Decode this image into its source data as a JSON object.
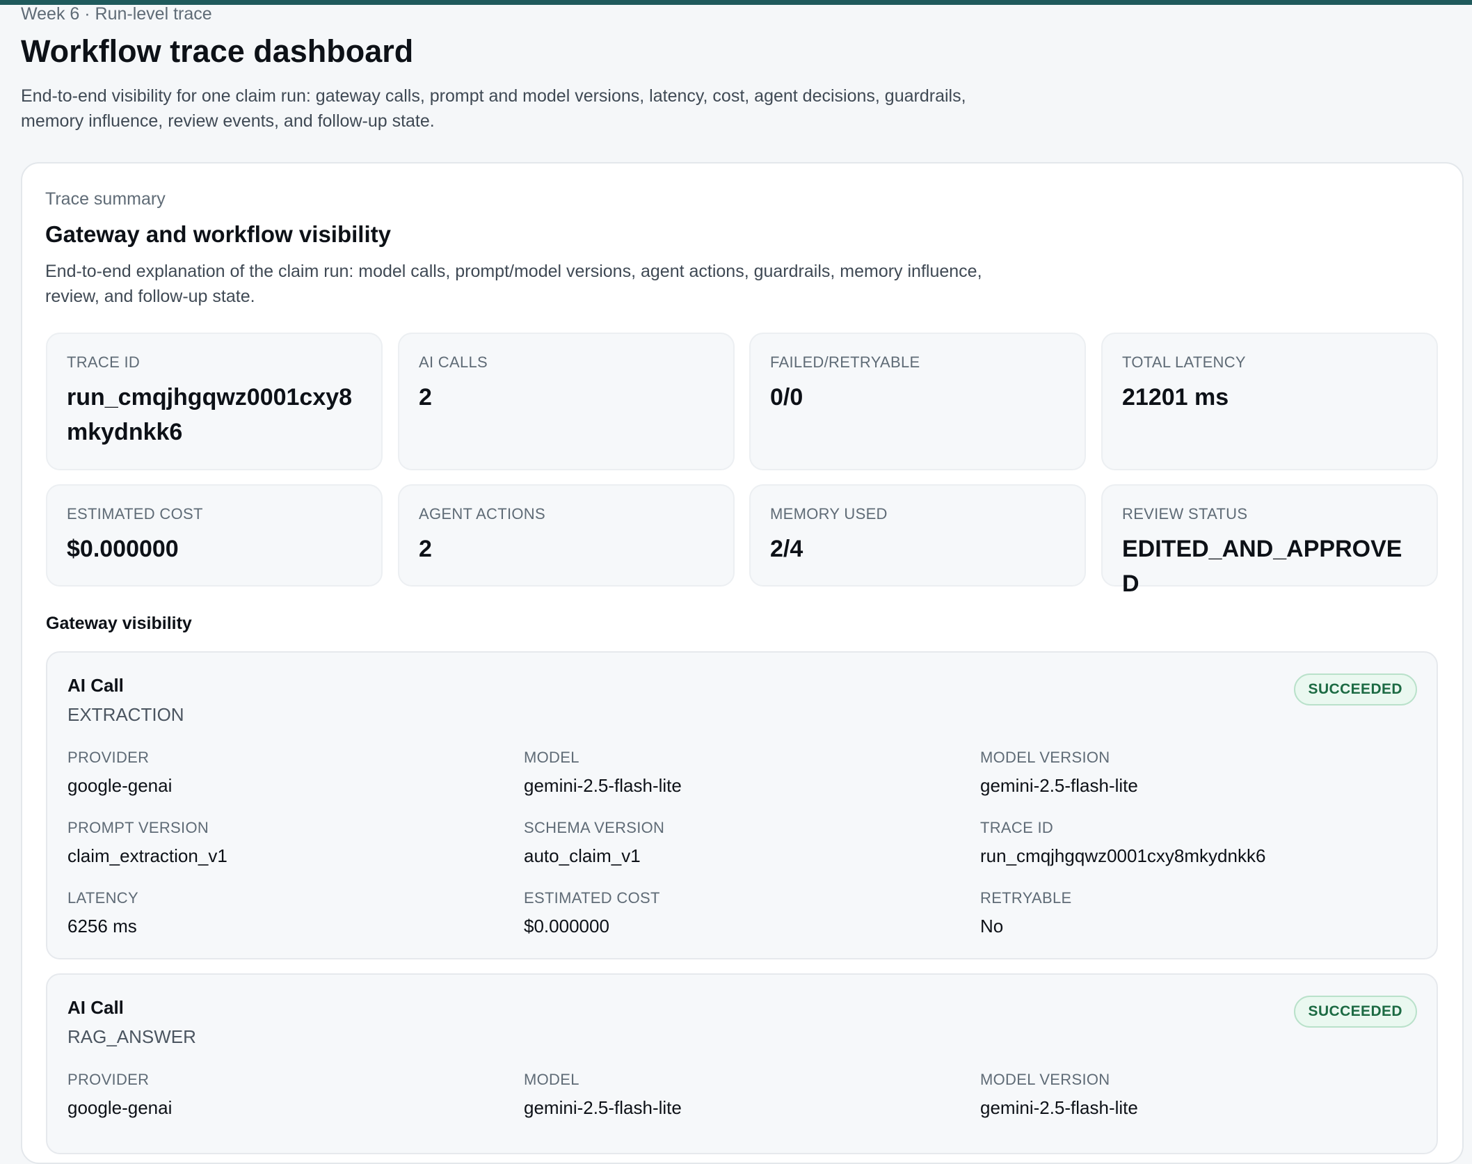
{
  "header": {
    "eyebrow": "Week 6 · Run-level trace",
    "title": "Workflow trace dashboard",
    "description": "End-to-end visibility for one claim run: gateway calls, prompt and model versions, latency, cost, agent decisions, guardrails, memory influence, review events, and follow-up state."
  },
  "summary": {
    "eyebrow": "Trace summary",
    "title": "Gateway and workflow visibility",
    "description": "End-to-end explanation of the claim run: model calls, prompt/model versions, agent actions, guardrails, memory influence, review, and follow-up state.",
    "metrics": [
      {
        "label": "Trace ID",
        "value": "run_cmqjhgqwz0001cxy8mkydnkk6"
      },
      {
        "label": "AI calls",
        "value": "2"
      },
      {
        "label": "Failed/Retryable",
        "value": "0/0"
      },
      {
        "label": "Total latency",
        "value": "21201 ms"
      },
      {
        "label": "Estimated cost",
        "value": "$0.000000"
      },
      {
        "label": "Agent actions",
        "value": "2"
      },
      {
        "label": "Memory used",
        "value": "2/4"
      },
      {
        "label": "Review status",
        "value": "EDITED_AND_APPROVED"
      }
    ]
  },
  "gateway": {
    "heading": "Gateway visibility",
    "calls": [
      {
        "title": "AI Call",
        "task": "EXTRACTION",
        "status": "SUCCEEDED",
        "status_color": "#1c6a43",
        "fields": [
          {
            "label": "Provider",
            "value": "google-genai"
          },
          {
            "label": "Model",
            "value": "gemini-2.5-flash-lite"
          },
          {
            "label": "Model version",
            "value": "gemini-2.5-flash-lite"
          },
          {
            "label": "Prompt version",
            "value": "claim_extraction_v1"
          },
          {
            "label": "Schema version",
            "value": "auto_claim_v1"
          },
          {
            "label": "Trace ID",
            "value": "run_cmqjhgqwz0001cxy8mkydnkk6"
          },
          {
            "label": "Latency",
            "value": "6256 ms"
          },
          {
            "label": "Estimated cost",
            "value": "$0.000000"
          },
          {
            "label": "Retryable",
            "value": "No"
          }
        ]
      },
      {
        "title": "AI Call",
        "task": "RAG_ANSWER",
        "status": "SUCCEEDED",
        "status_color": "#1c6a43",
        "fields": [
          {
            "label": "Provider",
            "value": "google-genai"
          },
          {
            "label": "Model",
            "value": "gemini-2.5-flash-lite"
          },
          {
            "label": "Model version",
            "value": "gemini-2.5-flash-lite"
          }
        ]
      }
    ]
  }
}
